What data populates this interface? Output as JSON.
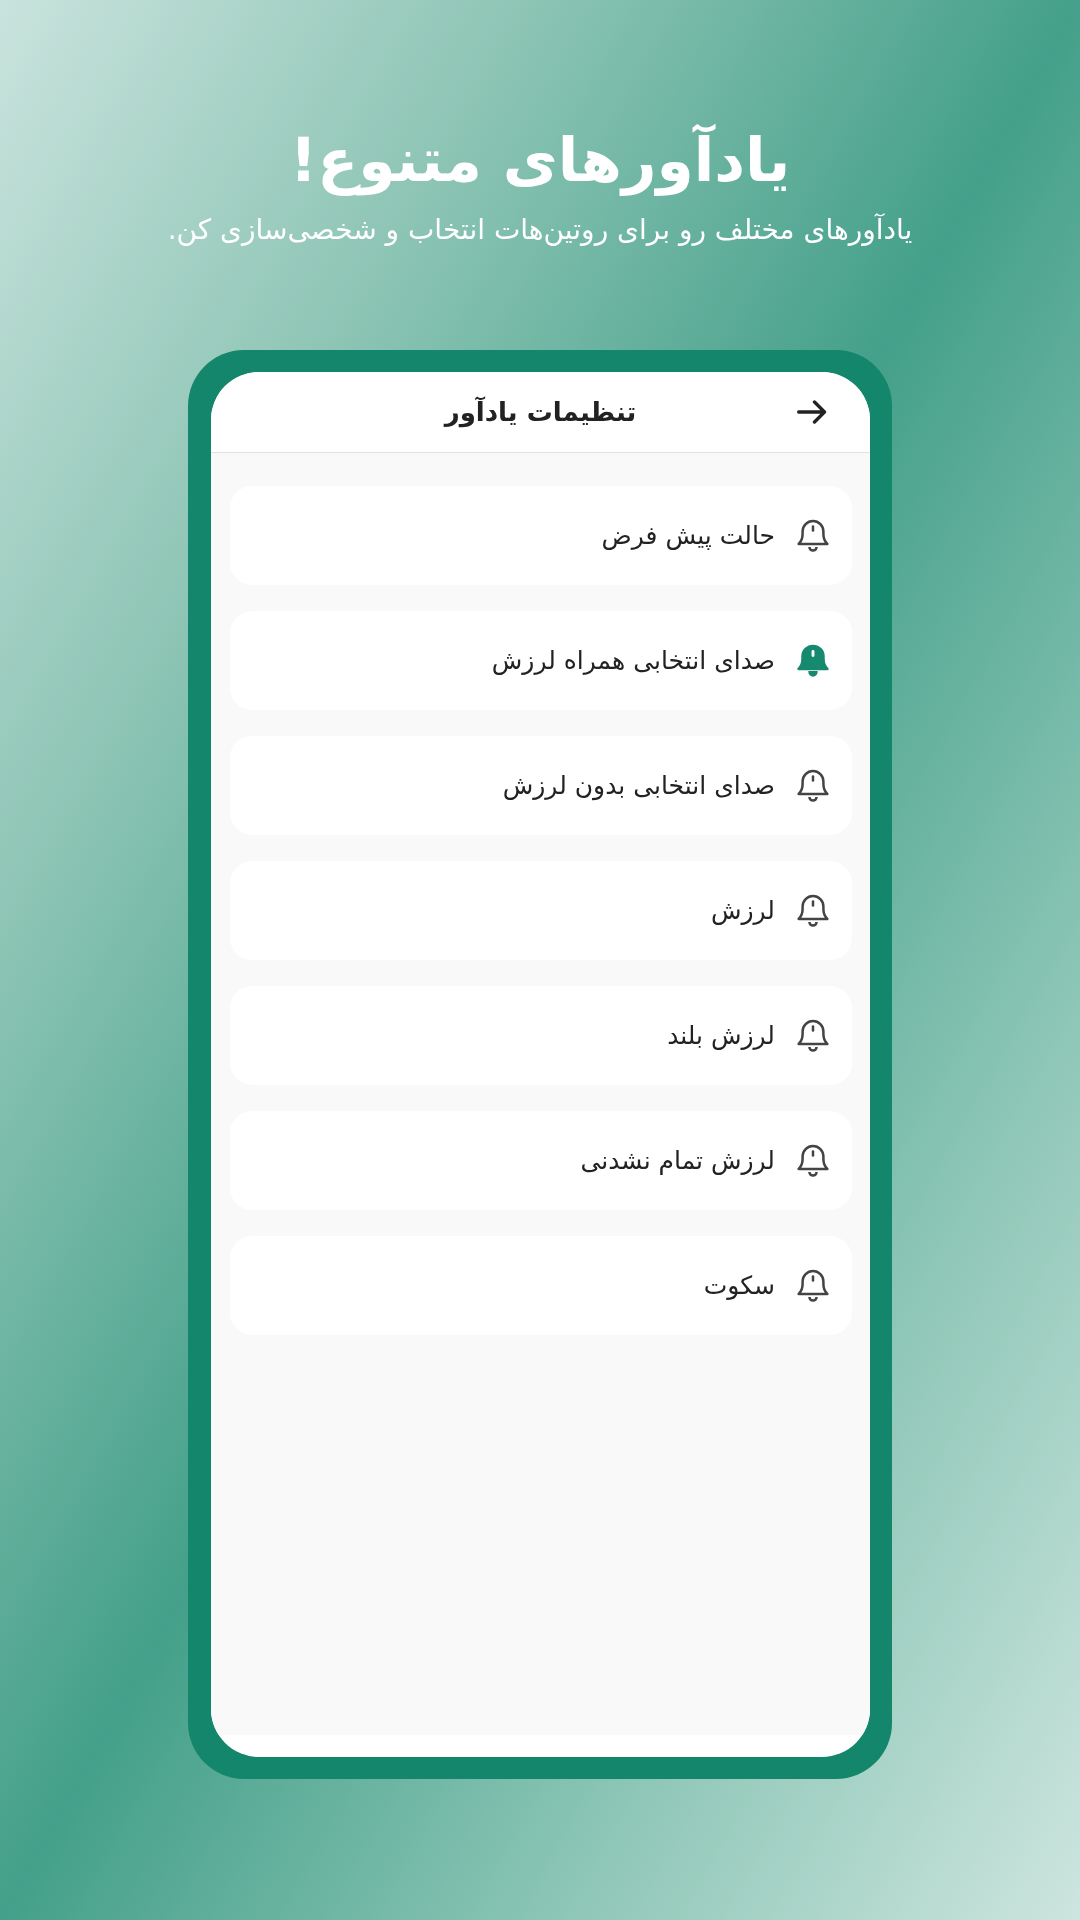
{
  "promo": {
    "title": "یادآورهای متنوع!",
    "subtitle": "یادآورهای مختلف رو برای روتین‌هات انتخاب و شخصی‌سازی کن."
  },
  "screen": {
    "title": "تنظیمات یادآور",
    "items": [
      {
        "label": "حالت پیش فرض",
        "selected": false
      },
      {
        "label": "صدای انتخابی همراه لرزش",
        "selected": true
      },
      {
        "label": "صدای انتخابی بدون لرزش",
        "selected": false
      },
      {
        "label": "لرزش",
        "selected": false
      },
      {
        "label": "لرزش بلند",
        "selected": false
      },
      {
        "label": "لرزش تمام نشدنی",
        "selected": false
      },
      {
        "label": "سکوت",
        "selected": false
      }
    ]
  }
}
